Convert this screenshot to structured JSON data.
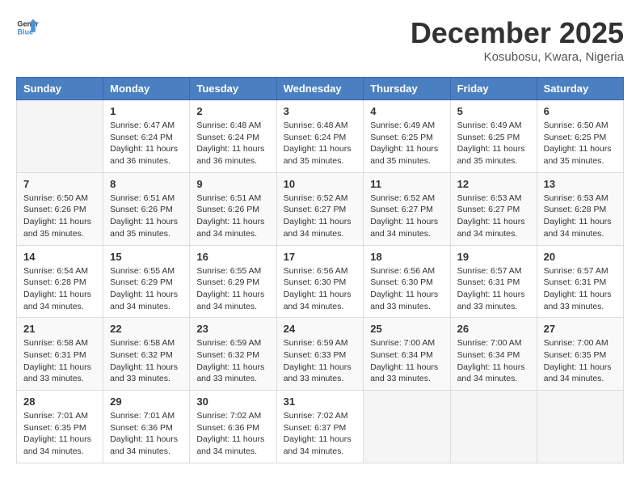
{
  "logo": {
    "general": "General",
    "blue": "Blue"
  },
  "title": "December 2025",
  "location": "Kosubosu, Kwara, Nigeria",
  "days_of_week": [
    "Sunday",
    "Monday",
    "Tuesday",
    "Wednesday",
    "Thursday",
    "Friday",
    "Saturday"
  ],
  "weeks": [
    [
      {
        "day": "",
        "info": ""
      },
      {
        "day": "1",
        "info": "Sunrise: 6:47 AM\nSunset: 6:24 PM\nDaylight: 11 hours and 36 minutes."
      },
      {
        "day": "2",
        "info": "Sunrise: 6:48 AM\nSunset: 6:24 PM\nDaylight: 11 hours and 36 minutes."
      },
      {
        "day": "3",
        "info": "Sunrise: 6:48 AM\nSunset: 6:24 PM\nDaylight: 11 hours and 35 minutes."
      },
      {
        "day": "4",
        "info": "Sunrise: 6:49 AM\nSunset: 6:25 PM\nDaylight: 11 hours and 35 minutes."
      },
      {
        "day": "5",
        "info": "Sunrise: 6:49 AM\nSunset: 6:25 PM\nDaylight: 11 hours and 35 minutes."
      },
      {
        "day": "6",
        "info": "Sunrise: 6:50 AM\nSunset: 6:25 PM\nDaylight: 11 hours and 35 minutes."
      }
    ],
    [
      {
        "day": "7",
        "info": "Sunrise: 6:50 AM\nSunset: 6:26 PM\nDaylight: 11 hours and 35 minutes."
      },
      {
        "day": "8",
        "info": "Sunrise: 6:51 AM\nSunset: 6:26 PM\nDaylight: 11 hours and 35 minutes."
      },
      {
        "day": "9",
        "info": "Sunrise: 6:51 AM\nSunset: 6:26 PM\nDaylight: 11 hours and 34 minutes."
      },
      {
        "day": "10",
        "info": "Sunrise: 6:52 AM\nSunset: 6:27 PM\nDaylight: 11 hours and 34 minutes."
      },
      {
        "day": "11",
        "info": "Sunrise: 6:52 AM\nSunset: 6:27 PM\nDaylight: 11 hours and 34 minutes."
      },
      {
        "day": "12",
        "info": "Sunrise: 6:53 AM\nSunset: 6:27 PM\nDaylight: 11 hours and 34 minutes."
      },
      {
        "day": "13",
        "info": "Sunrise: 6:53 AM\nSunset: 6:28 PM\nDaylight: 11 hours and 34 minutes."
      }
    ],
    [
      {
        "day": "14",
        "info": "Sunrise: 6:54 AM\nSunset: 6:28 PM\nDaylight: 11 hours and 34 minutes."
      },
      {
        "day": "15",
        "info": "Sunrise: 6:55 AM\nSunset: 6:29 PM\nDaylight: 11 hours and 34 minutes."
      },
      {
        "day": "16",
        "info": "Sunrise: 6:55 AM\nSunset: 6:29 PM\nDaylight: 11 hours and 34 minutes."
      },
      {
        "day": "17",
        "info": "Sunrise: 6:56 AM\nSunset: 6:30 PM\nDaylight: 11 hours and 34 minutes."
      },
      {
        "day": "18",
        "info": "Sunrise: 6:56 AM\nSunset: 6:30 PM\nDaylight: 11 hours and 33 minutes."
      },
      {
        "day": "19",
        "info": "Sunrise: 6:57 AM\nSunset: 6:31 PM\nDaylight: 11 hours and 33 minutes."
      },
      {
        "day": "20",
        "info": "Sunrise: 6:57 AM\nSunset: 6:31 PM\nDaylight: 11 hours and 33 minutes."
      }
    ],
    [
      {
        "day": "21",
        "info": "Sunrise: 6:58 AM\nSunset: 6:31 PM\nDaylight: 11 hours and 33 minutes."
      },
      {
        "day": "22",
        "info": "Sunrise: 6:58 AM\nSunset: 6:32 PM\nDaylight: 11 hours and 33 minutes."
      },
      {
        "day": "23",
        "info": "Sunrise: 6:59 AM\nSunset: 6:32 PM\nDaylight: 11 hours and 33 minutes."
      },
      {
        "day": "24",
        "info": "Sunrise: 6:59 AM\nSunset: 6:33 PM\nDaylight: 11 hours and 33 minutes."
      },
      {
        "day": "25",
        "info": "Sunrise: 7:00 AM\nSunset: 6:34 PM\nDaylight: 11 hours and 33 minutes."
      },
      {
        "day": "26",
        "info": "Sunrise: 7:00 AM\nSunset: 6:34 PM\nDaylight: 11 hours and 34 minutes."
      },
      {
        "day": "27",
        "info": "Sunrise: 7:00 AM\nSunset: 6:35 PM\nDaylight: 11 hours and 34 minutes."
      }
    ],
    [
      {
        "day": "28",
        "info": "Sunrise: 7:01 AM\nSunset: 6:35 PM\nDaylight: 11 hours and 34 minutes."
      },
      {
        "day": "29",
        "info": "Sunrise: 7:01 AM\nSunset: 6:36 PM\nDaylight: 11 hours and 34 minutes."
      },
      {
        "day": "30",
        "info": "Sunrise: 7:02 AM\nSunset: 6:36 PM\nDaylight: 11 hours and 34 minutes."
      },
      {
        "day": "31",
        "info": "Sunrise: 7:02 AM\nSunset: 6:37 PM\nDaylight: 11 hours and 34 minutes."
      },
      {
        "day": "",
        "info": ""
      },
      {
        "day": "",
        "info": ""
      },
      {
        "day": "",
        "info": ""
      }
    ]
  ]
}
